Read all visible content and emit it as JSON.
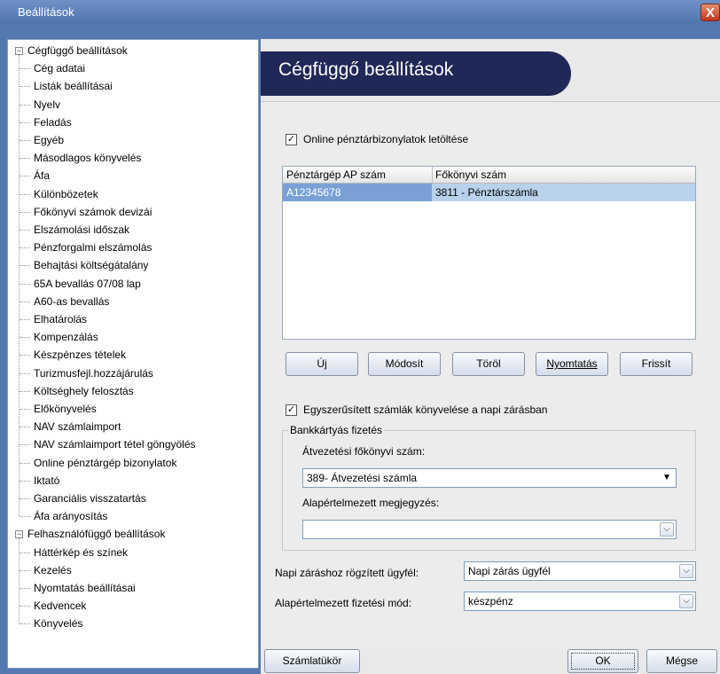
{
  "window": {
    "title": "Beállítások",
    "close_glyph": "X"
  },
  "tree": {
    "groups": [
      {
        "label": "Cégfüggő beállítások",
        "expander": "−",
        "items": [
          "Cég adatai",
          "Listák beállításai",
          "Nyelv",
          "Feladás",
          "Egyéb",
          "Másodlagos könyvelés",
          "Áfa",
          "Különbözetek",
          "Főkönyvi számok devizái",
          "Elszámolási időszak",
          "Pénzforgalmi elszámolás",
          "Behajtási költségátalány",
          "65A bevallás 07/08 lap",
          "A60-as bevallás",
          "Elhatárolás",
          "Kompenzálás",
          "Készpénzes tételek",
          "Turizmusfejl.hozzájárulás",
          "Költséghely felosztás",
          "Előkönyvelés",
          "NAV számlaimport",
          "NAV számlaimport tétel göngyölés",
          "Online pénztárgép bizonylatok",
          "Iktató",
          "Garanciális visszatartás",
          "Áfa arányosítás"
        ]
      },
      {
        "label": "Felhasználófüggő beállítások",
        "expander": "−",
        "items": [
          "Háttérkép és színek",
          "Kezelés",
          "Nyomtatás beállításai",
          "Kedvencek",
          "Könyvelés"
        ]
      }
    ],
    "selected": "Online pénztárgép bizonylatok"
  },
  "header": {
    "title": "Cégfüggő beállítások"
  },
  "online_download": {
    "checked": true,
    "check_glyph": "✓",
    "label": "Online pénztárbizonylatok letöltése"
  },
  "grid": {
    "columns": [
      "Pénztárgép AP szám",
      "Főkönyvi szám"
    ],
    "rows": [
      [
        "A12345678",
        "3811 - Pénztárszámla"
      ]
    ]
  },
  "grid_buttons": {
    "new": "Új",
    "edit": "Módosít",
    "delete": "Töröl",
    "print": "Nyomtatás",
    "refresh": "Frissít"
  },
  "simplified_invoices": {
    "checked": true,
    "check_glyph": "✓",
    "label": "Egyszerűsített számlák könyvelése a napi zárásban"
  },
  "card_payment": {
    "group_title": "Bankkártyás fizetés",
    "transfer_label": "Átvezetési főkönyvi szám:",
    "transfer_value": "389- Átvezetési számla",
    "comment_label": "Alapértelmezett megjegyzés:",
    "comment_value": ""
  },
  "daily_client": {
    "label": "Napi záráshoz rögzített ügyfél:",
    "value": "Napi zárás ügyfél"
  },
  "payment_mode": {
    "label": "Alapértelmezett fizetési mód:",
    "value": "készpénz"
  },
  "bottom_buttons": {
    "chart": "Számlatükör",
    "ok": "OK",
    "cancel": "Mégse"
  },
  "icons": {
    "dropdown": "chevron-down-icon",
    "dropdown_solid": "triangle-down-icon"
  },
  "colors": {
    "header_band": "#1f2857",
    "selection": "#7aa1d6",
    "row_highlight": "#b9d1ea"
  }
}
